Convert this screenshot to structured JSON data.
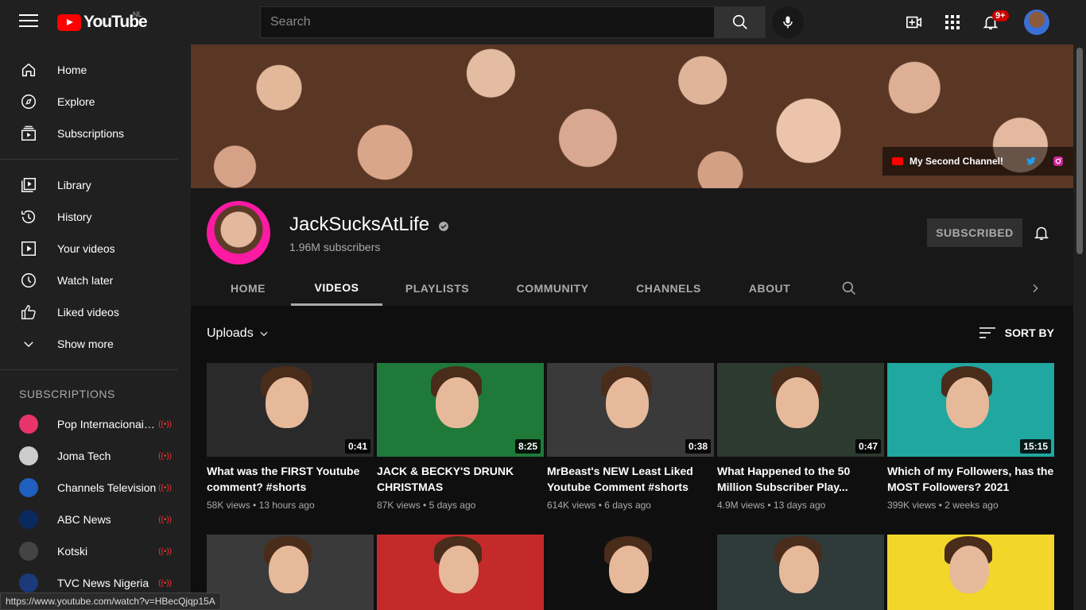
{
  "topbar": {
    "logo_text": "YouTube",
    "region": "NL",
    "search_placeholder": "Search",
    "notification_count": "9+"
  },
  "sidebar": {
    "main": [
      {
        "label": "Home",
        "icon": "home-icon"
      },
      {
        "label": "Explore",
        "icon": "compass-icon"
      },
      {
        "label": "Subscriptions",
        "icon": "subscriptions-icon"
      }
    ],
    "library": [
      {
        "label": "Library",
        "icon": "library-icon"
      },
      {
        "label": "History",
        "icon": "history-icon"
      },
      {
        "label": "Your videos",
        "icon": "your-videos-icon"
      },
      {
        "label": "Watch later",
        "icon": "clock-icon"
      },
      {
        "label": "Liked videos",
        "icon": "thumbs-up-icon"
      },
      {
        "label": "Show more",
        "icon": "chevron-down-icon"
      }
    ],
    "subscriptions_heading": "SUBSCRIPTIONS",
    "subscriptions": [
      {
        "label": "Pop Internacionais...",
        "color": "#e8336b"
      },
      {
        "label": "Joma Tech",
        "color": "#cccccc"
      },
      {
        "label": "Channels Television",
        "color": "#1f5fbf"
      },
      {
        "label": "ABC News",
        "color": "#0a2a5e"
      },
      {
        "label": "Kotski",
        "color": "#444444"
      },
      {
        "label": "TVC News Nigeria",
        "color": "#1a3a7a"
      }
    ]
  },
  "banner": {
    "link_label": "My Second Channel!"
  },
  "channel": {
    "name": "JackSucksAtLife",
    "subscribers": "1.96M subscribers",
    "subscribe_label": "SUBSCRIBED"
  },
  "tabs": [
    {
      "label": "HOME"
    },
    {
      "label": "VIDEOS"
    },
    {
      "label": "PLAYLISTS"
    },
    {
      "label": "COMMUNITY"
    },
    {
      "label": "CHANNELS"
    },
    {
      "label": "ABOUT"
    }
  ],
  "content": {
    "uploads_label": "Uploads",
    "sort_label": "SORT BY",
    "videos": [
      {
        "title": "What was the FIRST Youtube comment? #shorts",
        "views": "58K views",
        "age": "13 hours ago",
        "duration": "0:41",
        "bg": "#2a2a2a"
      },
      {
        "title": "JACK & BECKY'S DRUNK CHRISTMAS",
        "views": "87K views",
        "age": "5 days ago",
        "duration": "8:25",
        "bg": "#1f7a3a"
      },
      {
        "title": "MrBeast's NEW Least Liked Youtube Comment #shorts",
        "views": "614K views",
        "age": "6 days ago",
        "duration": "0:38",
        "bg": "#3a3a3a"
      },
      {
        "title": "What Happened to the 50 Million Subscriber Play...",
        "views": "4.9M views",
        "age": "13 days ago",
        "duration": "0:47",
        "bg": "#2d3a2f"
      },
      {
        "title": "Which of my Followers, has the MOST Followers? 2021",
        "views": "399K views",
        "age": "2 weeks ago",
        "duration": "15:15",
        "bg": "#1fa7a0"
      }
    ],
    "row2": [
      {
        "bg": "#3a3a3a"
      },
      {
        "bg": "#c42a2a"
      },
      {
        "bg": "#101010"
      },
      {
        "bg": "#2f3a3a"
      },
      {
        "bg": "#f2d62a"
      }
    ]
  },
  "status_url": "https://www.youtube.com/watch?v=HBecQjqp15A"
}
